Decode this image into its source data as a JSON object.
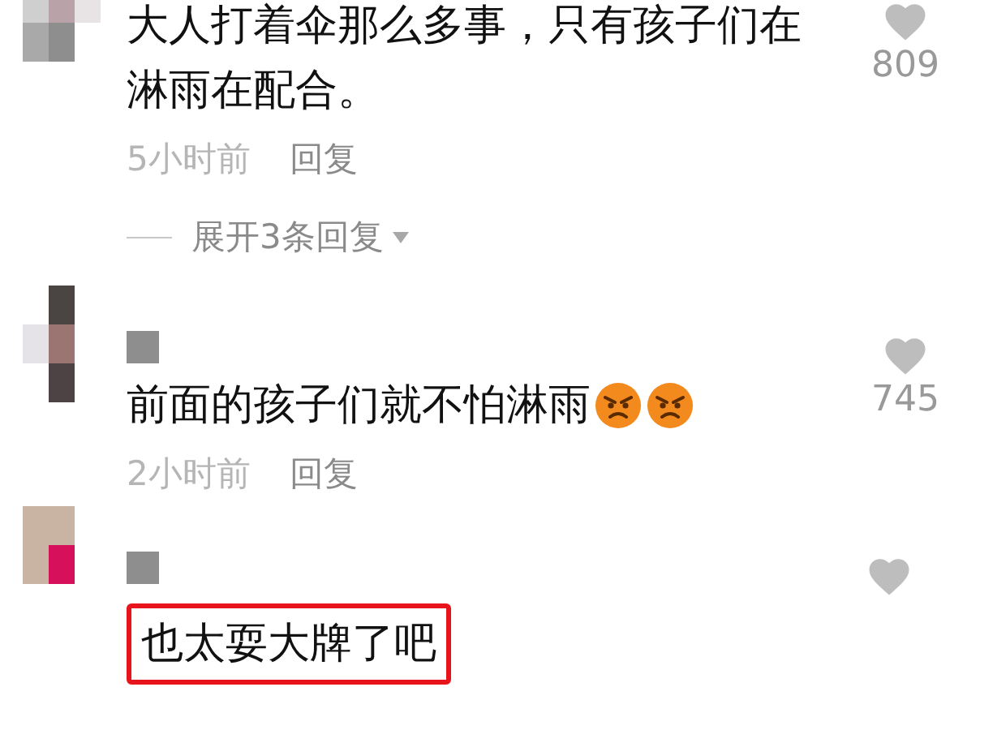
{
  "comments": [
    {
      "text": "大人打着伞那么多事，只有孩子们在淋雨在配合。",
      "likes": "809",
      "time": "5小时前",
      "reply": "回复",
      "expand": "展开3条回复",
      "highlighted": false
    },
    {
      "text": "前面的孩子们就不怕淋雨",
      "emojis": [
        {
          "kind": "angry"
        },
        {
          "kind": "angry"
        }
      ],
      "likes": "745",
      "time": "2小时前",
      "reply": "回复",
      "highlighted": false
    },
    {
      "text": "也太耍大牌了吧",
      "highlighted": true
    }
  ]
}
